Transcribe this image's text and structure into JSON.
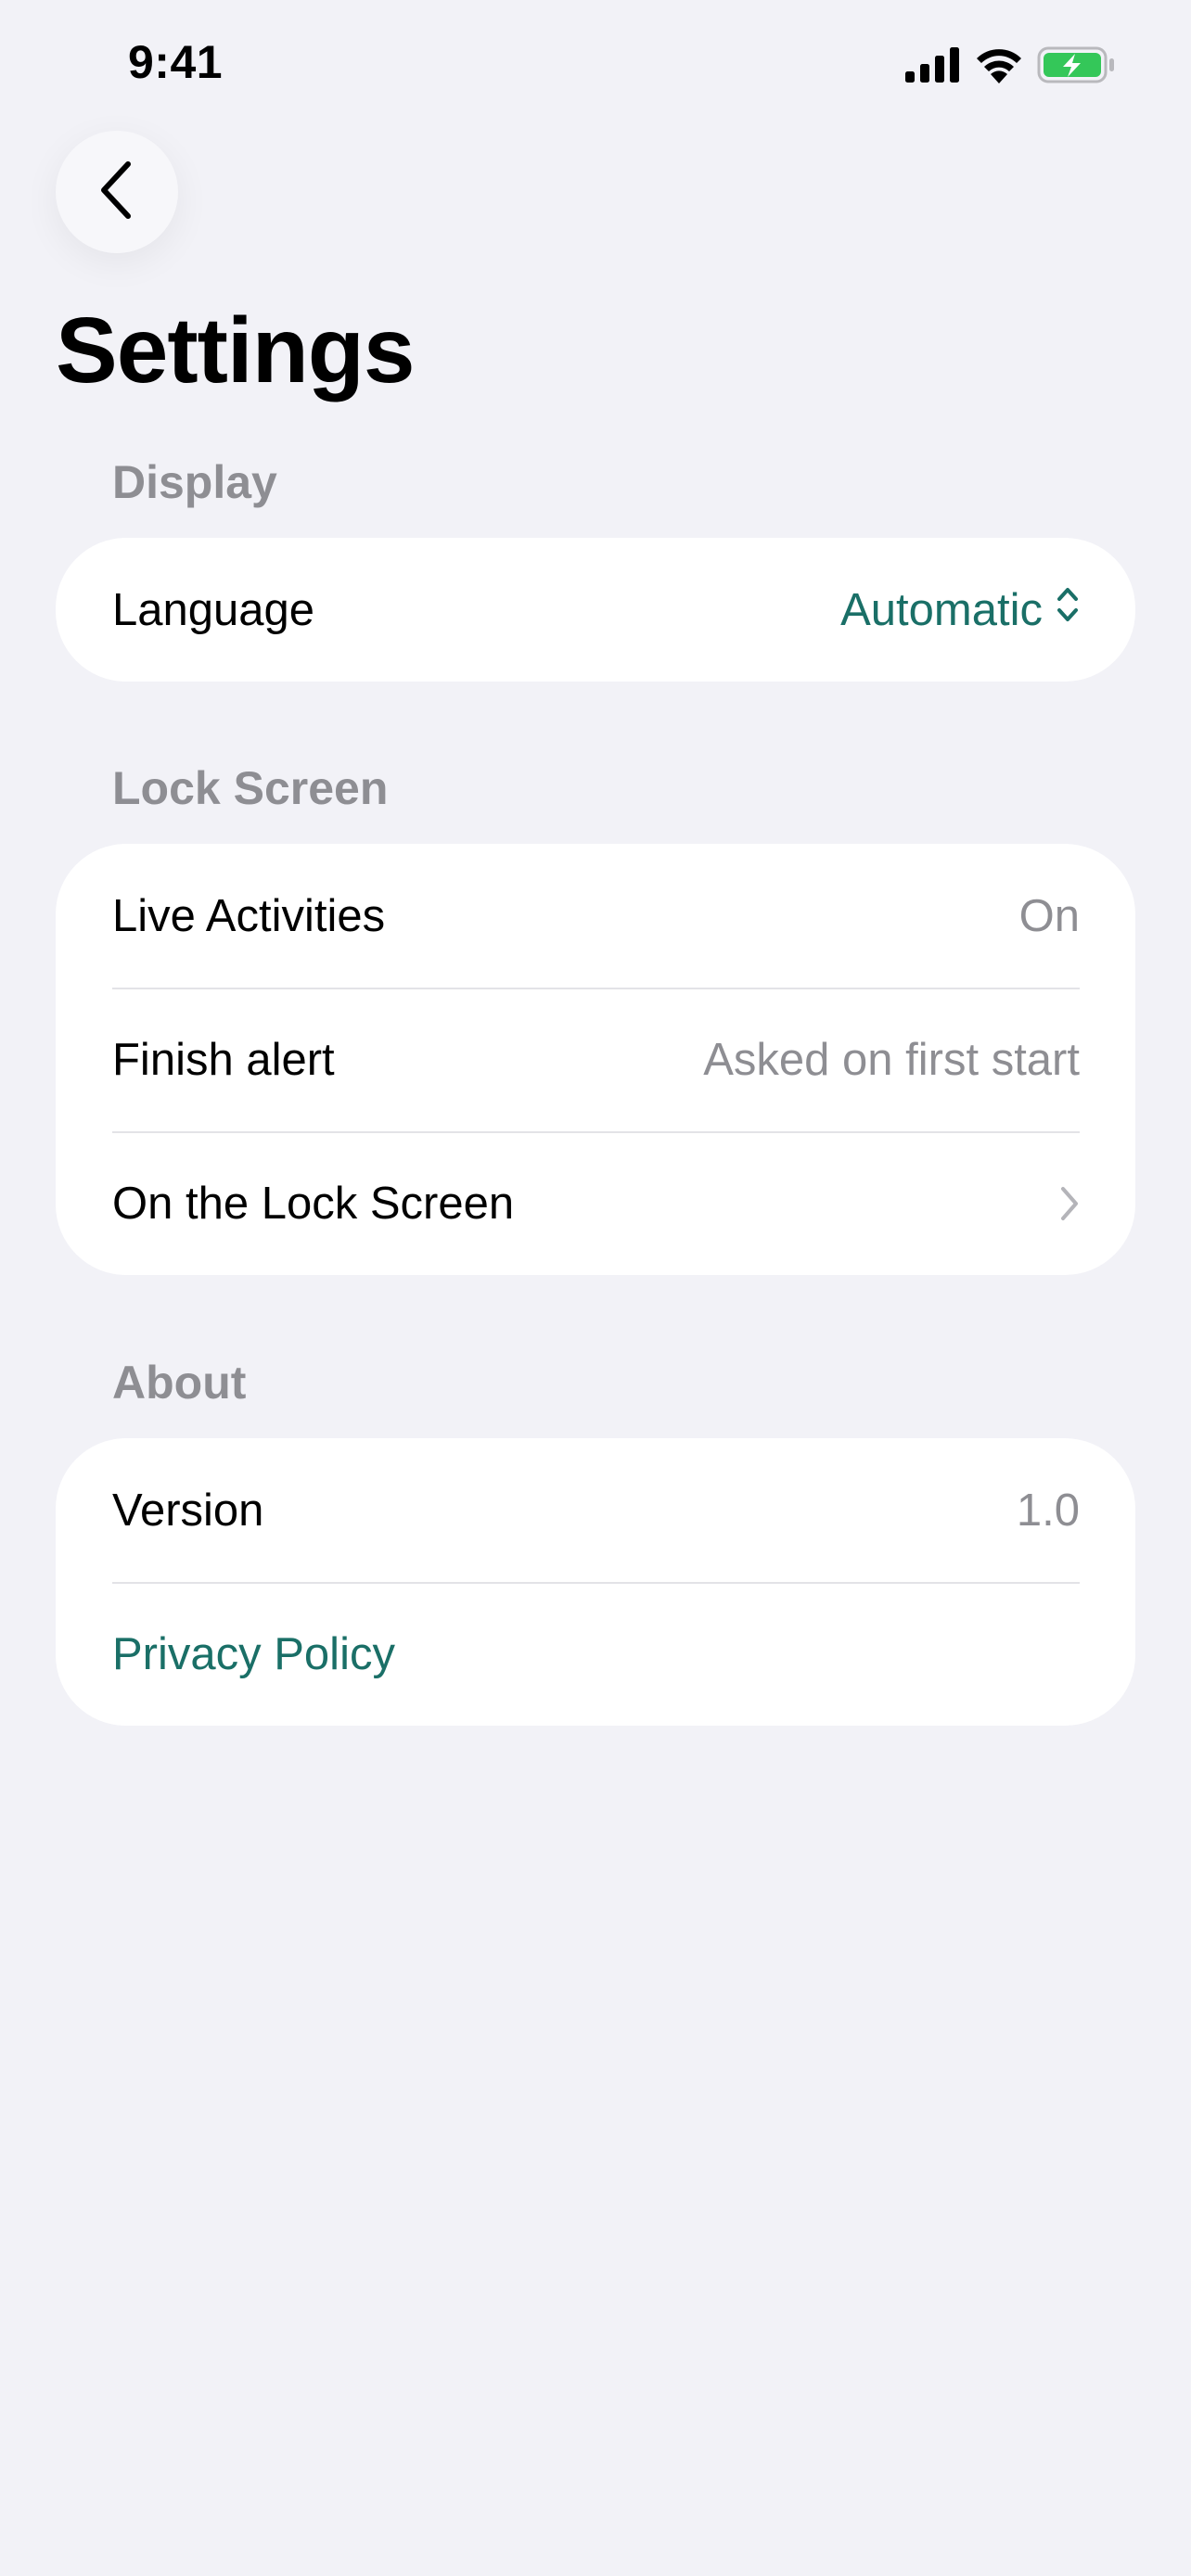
{
  "status_bar": {
    "time": "9:41",
    "icons": [
      "cellular-signal-icon",
      "wifi-icon",
      "battery-charging-icon"
    ],
    "battery_color": "#34c759"
  },
  "nav": {
    "back_icon": "chevron-left-icon"
  },
  "page": {
    "title": "Settings"
  },
  "sections": {
    "display": {
      "header": "Display",
      "language_label": "Language",
      "language_value": "Automatic",
      "language_icon": "chevron-up-down-icon"
    },
    "lock_screen": {
      "header": "Lock Screen",
      "live_activities_label": "Live Activities",
      "live_activities_value": "On",
      "finish_alert_label": "Finish alert",
      "finish_alert_value": "Asked on first start",
      "on_lock_screen_label": "On the Lock Screen",
      "on_lock_screen_icon": "chevron-right-icon"
    },
    "about": {
      "header": "About",
      "version_label": "Version",
      "version_value": "1.0",
      "privacy_label": "Privacy Policy"
    }
  },
  "colors": {
    "background": "#f2f2f7",
    "accent": "#1a6f67",
    "secondary_text": "#8e8e93"
  }
}
